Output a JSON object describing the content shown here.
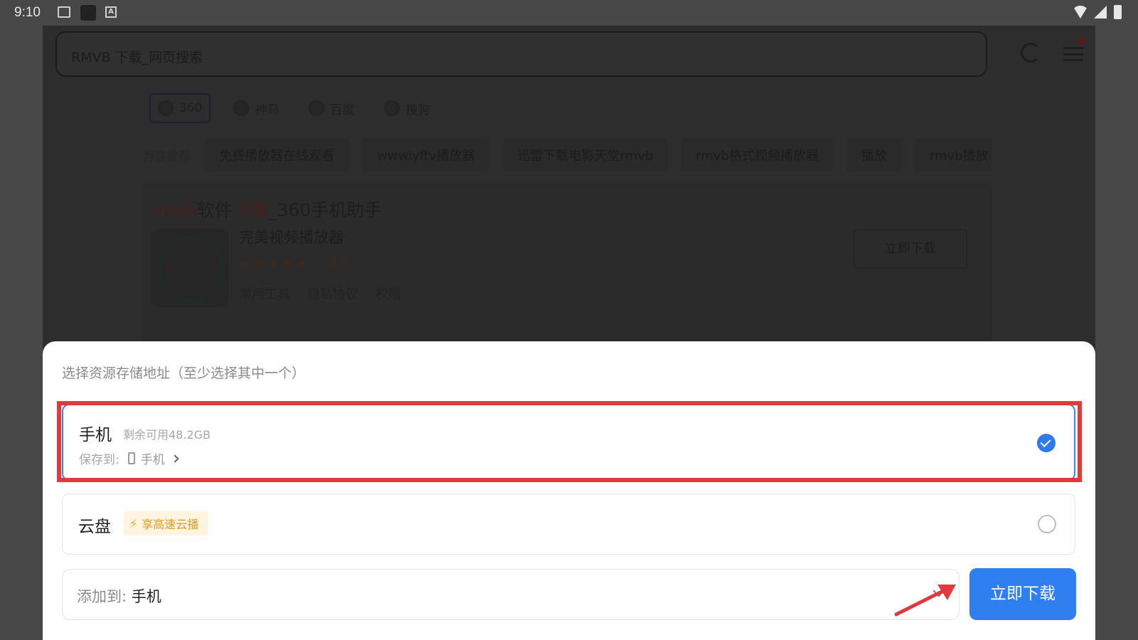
{
  "status_bar": {
    "time": "9:10"
  },
  "browser": {
    "address": "RMVB 下载_网页搜索",
    "engines": [
      {
        "label": "360"
      },
      {
        "label": "神马"
      },
      {
        "label": "百度"
      },
      {
        "label": "搜狗"
      }
    ],
    "chips_lead": "为您推荐",
    "chips": [
      "免费播放器在线观看",
      "wwwiyftv播放器",
      "迅雷下载电影天堂rmvb",
      "rmvb格式视频播放器",
      "播放",
      "rmvb播放"
    ],
    "result": {
      "title_pre": "rmvb",
      "title_mid": "软件",
      "title_red": "下载",
      "title_post": "_360手机助手",
      "app_name": "完美视频播放器",
      "stars": "★★★★★",
      "score": "9.5",
      "meta": [
        "常用工具",
        "隐私协议",
        "权限"
      ],
      "button": "立即下载"
    }
  },
  "sheet": {
    "title": "选择资源存储地址（至少选择其中一个）",
    "phone_option": {
      "name": "手机",
      "space": "剩余可用48.2GB",
      "path_label": "保存到:",
      "path_value": "手机",
      "selected": true
    },
    "cloud_option": {
      "name": "云盘",
      "badge": "享高速云播",
      "selected": false
    },
    "add_to": {
      "label": "添加到:",
      "value": "手机"
    },
    "download_button": "立即下载"
  },
  "colors": {
    "accent": "#2f7ff0",
    "highlight": "#e03a3f",
    "badge_text": "#e09a1c"
  }
}
